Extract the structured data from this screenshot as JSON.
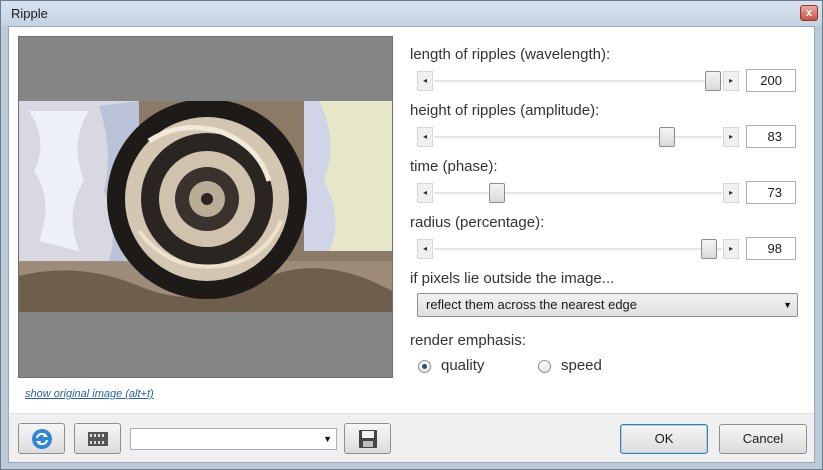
{
  "window": {
    "title": "Ripple",
    "close_glyph": "x"
  },
  "preview": {
    "show_original_link": "show original image (alt+t)"
  },
  "controls": {
    "wavelength": {
      "label": "length of ripples (wavelength):",
      "value": "200",
      "fraction": 0.97
    },
    "amplitude": {
      "label": "height of ripples (amplitude):",
      "value": "83",
      "fraction": 0.83
    },
    "phase": {
      "label": "time (phase):",
      "value": "73",
      "fraction": 0.27
    },
    "radius": {
      "label": "radius (percentage):",
      "value": "98",
      "fraction": 0.98
    }
  },
  "edge": {
    "label": "if pixels lie outside the image...",
    "selected": "reflect them across the nearest edge"
  },
  "render": {
    "label": "render emphasis:",
    "options": [
      {
        "label": "quality",
        "checked": true
      },
      {
        "label": "speed",
        "checked": false
      }
    ]
  },
  "footer": {
    "ok_label": "OK",
    "cancel_label": "Cancel",
    "preset_value": ""
  },
  "icons": {
    "arrow_left": "◂",
    "arrow_right": "▸",
    "dropdown": "▼"
  },
  "colors": {
    "link": "#2a5fa8",
    "accent": "#3c7fb1"
  }
}
